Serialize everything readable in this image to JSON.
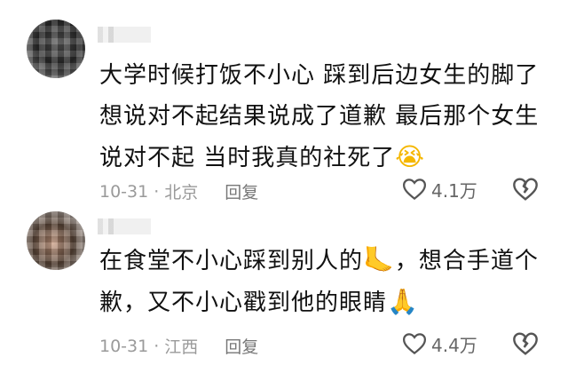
{
  "comments": [
    {
      "lines": [
        "大学时候打饭不小心 踩到后边女生的脚了",
        "想说对不起结果说成了道歉 最后那个女生",
        "说对不起 当时我真的社死了"
      ],
      "emoji": "😭",
      "date": "10-31",
      "location": "北京",
      "reply": "回复",
      "likes": "4.1万"
    },
    {
      "lines": [
        "在食堂不小心踩到别人的",
        "，想合手道个",
        "歉，又不小心戳到他的眼睛"
      ],
      "emoji_foot": "🦶",
      "emoji_pray": "🙏",
      "date": "10-31",
      "location": "江西",
      "reply": "回复",
      "likes": "4.4万"
    }
  ],
  "separator": "·",
  "icons": [
    "avatar-image",
    "heart-icon",
    "broken-heart-icon"
  ]
}
